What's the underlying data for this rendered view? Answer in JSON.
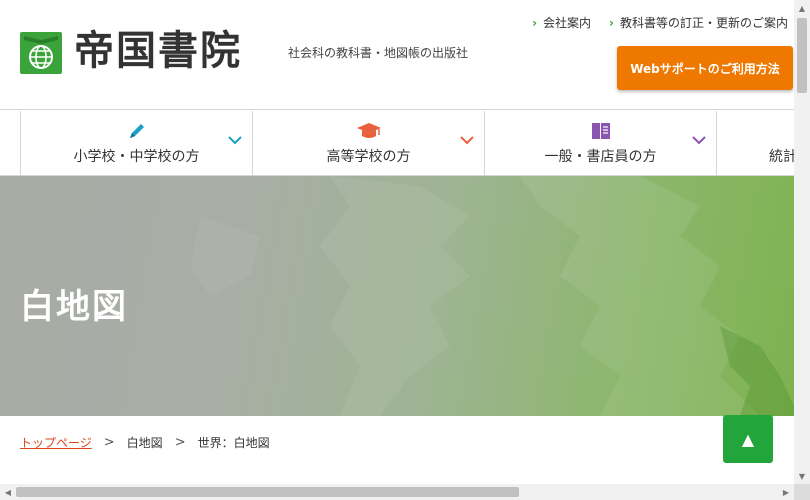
{
  "header": {
    "logo_text": "帝国書院",
    "tagline": "社会科の教科書・地図帳の出版社",
    "top_links": [
      {
        "label": "会社案内"
      },
      {
        "label": "教科書等の訂正・更新のご案内"
      }
    ],
    "web_support_label": "Webサポートのご利用方法",
    "colors": {
      "brand_green": "#3aa33a",
      "accent_orange": "#ee7800"
    }
  },
  "nav": {
    "items": [
      {
        "label": "小学校・中学校の方",
        "icon": "pencil-icon",
        "color": "#1a9fc9"
      },
      {
        "label": "高等学校の方",
        "icon": "graduation-cap-icon",
        "color": "#e8603c"
      },
      {
        "label": "一般・書店員の方",
        "icon": "book-icon",
        "color": "#8a55b0"
      },
      {
        "label": "統計",
        "icon": "chart-icon",
        "color": "#3aa33a"
      }
    ]
  },
  "hero": {
    "title": "白地図"
  },
  "breadcrumb": {
    "items": [
      "トップページ",
      "白地図",
      "世界：白地図"
    ]
  },
  "to_top": {
    "label": "▲",
    "color": "#22a53a"
  }
}
